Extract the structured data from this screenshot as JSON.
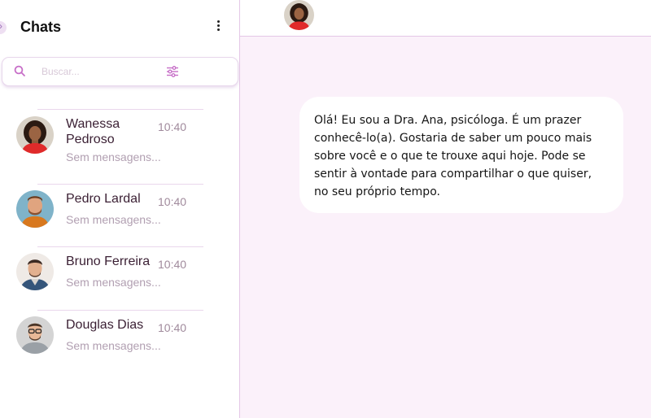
{
  "sidebar": {
    "title": "Chats",
    "search": {
      "placeholder": "Buscar..."
    },
    "chats": [
      {
        "name": "Wanessa Pedroso",
        "time": "10:40",
        "preview": "Sem mensagens...",
        "avatar": "woman-curly-hair-red-shirt"
      },
      {
        "name": "Pedro Lardal",
        "time": "10:40",
        "preview": "Sem mensagens...",
        "avatar": "man-beard-orange-shirt"
      },
      {
        "name": "Bruno Ferreira",
        "time": "10:40",
        "preview": "Sem mensagens...",
        "avatar": "man-smiling-denim-jacket"
      },
      {
        "name": "Douglas Dias",
        "time": "10:40",
        "preview": "Sem mensagens...",
        "avatar": "man-glasses-grey-shirt"
      }
    ]
  },
  "conversation": {
    "messages": [
      {
        "text": "Olá! Eu sou a Dra. Ana, psicóloga. É um prazer conhecê-lo(a). Gostaria de saber um pouco mais sobre você e o que te trouxe aqui hoje. Pode se sentir à vontade para compartilhar o que quiser, no seu próprio tempo."
      }
    ]
  },
  "colors": {
    "accent": "#d9a3dd",
    "chat_background": "#fbf1fa",
    "text_primary": "#3a1f33"
  },
  "icons": [
    "back-icon",
    "more-vert-icon",
    "search-icon",
    "filter-icon"
  ]
}
